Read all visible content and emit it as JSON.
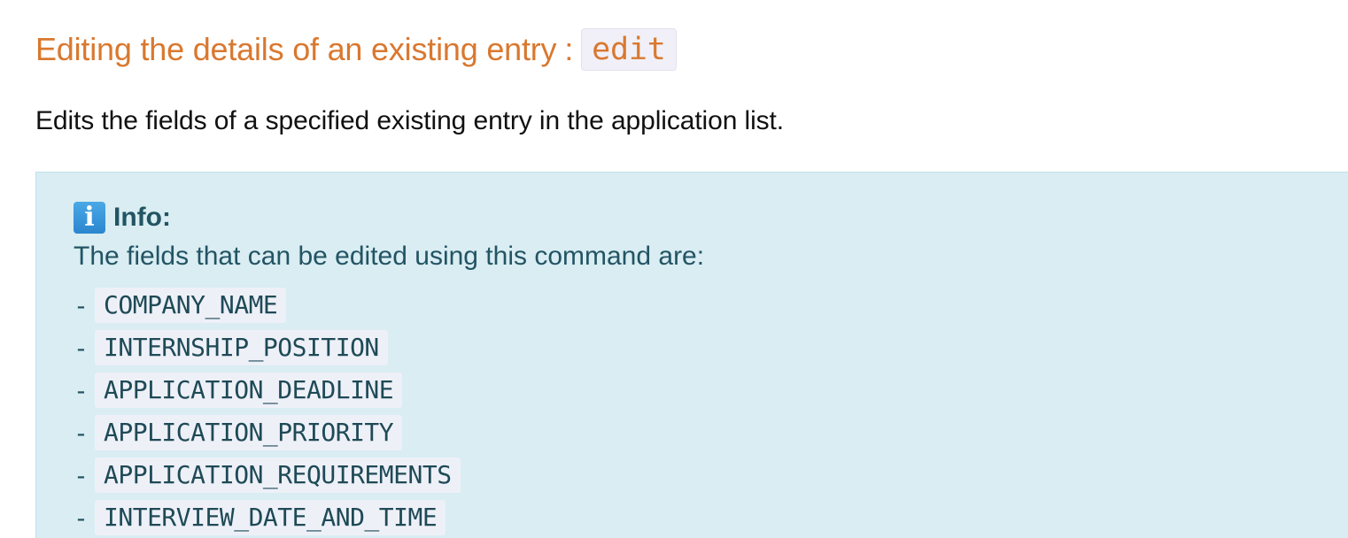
{
  "heading": {
    "text": "Editing the details of an existing entry",
    "separator": ":",
    "command": "edit"
  },
  "description": "Edits the fields of a specified existing entry in the application list.",
  "callout": {
    "icon": "info-icon",
    "icon_glyph": "i",
    "title": "Info:",
    "text": "The fields that can be edited using this command are:",
    "bullet": "-",
    "fields": [
      "COMPANY_NAME",
      "INTERNSHIP_POSITION",
      "APPLICATION_DEADLINE",
      "APPLICATION_PRIORITY",
      "APPLICATION_REQUIREMENTS",
      "INTERVIEW_DATE_AND_TIME"
    ]
  },
  "colors": {
    "heading": "#d9782f",
    "callout_background": "#d9edf3",
    "callout_text": "#235463",
    "code_background": "#eef0f8"
  }
}
